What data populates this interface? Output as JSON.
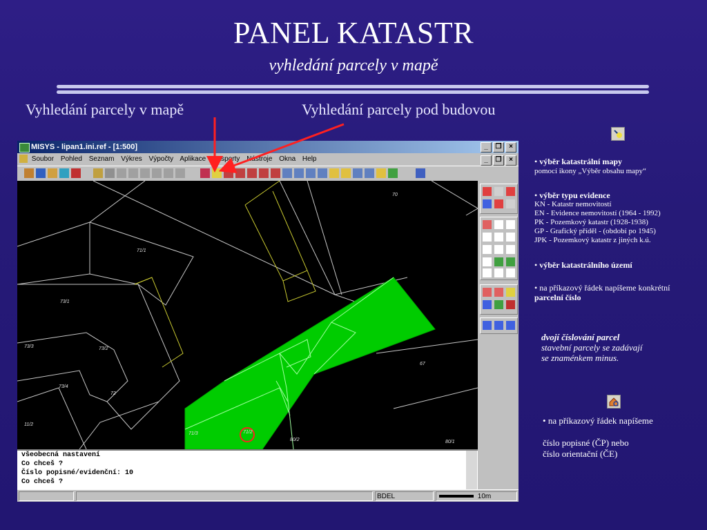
{
  "slide": {
    "title": "PANEL KATASTR",
    "subtitle": "vyhledání parcely v mapě",
    "caption_left": "Vyhledání parcely v mapě",
    "caption_right": "Vyhledání parcely pod budovou"
  },
  "window": {
    "title": "MISYS - lipan1.ini.ref - [1:500]",
    "menu": [
      "Soubor",
      "Pohled",
      "Seznam",
      "Výkres",
      "Výpočty",
      "Aplikace",
      "Pasporty",
      "Nástroje",
      "Okna",
      "Help"
    ],
    "map_labels": [
      "70",
      "71/1",
      "73/1",
      "73/2",
      "73/3",
      "73/4",
      "72",
      "67",
      "71/2",
      "71/3",
      "80/2",
      "80/1",
      "11/2"
    ],
    "command_lines": [
      "všeobecná nastavení",
      "Co chceš ?",
      "Číslo popisné/evidenční: 10",
      "Co chceš ?"
    ],
    "status": {
      "mode": "BDEL",
      "scale": "10m"
    }
  },
  "right_panel": {
    "b1_bullet": "•",
    "b1_bold": "výběr katastrální mapy",
    "b1_text": "pomocí ikony „Výběr obsahu mapy“",
    "b2_bold": "výběr typu evidence",
    "evidence": [
      "KN  - Katastr nemovitostí",
      "EN  - Evidence nemovitostí (1964 - 1992)",
      "PK  - Pozemkový katastr (1928-1938)",
      "GP  - Grafický příděl - (období po 1945)",
      "JPK - Pozemkový katastr z jiných k.ú."
    ],
    "b3_bold": "výběr katastrálního území",
    "b4_text": "na příkazový řádek napíšeme konkrétní",
    "b4_bold": "parcelní číslo",
    "italic_title": "dvojí číslování parcel",
    "italic_line1": "stavební parcely se zadávají",
    "italic_line2": "se znaménkem minus.",
    "b5_text": "na příkazový řádek napíšeme",
    "b5_line2": "číslo popisné (ČP) nebo",
    "b5_line3": "číslo orientační (ČE)"
  },
  "colors": {
    "parcel_fill": "#00cc00",
    "arrow": "#ff2020",
    "background": "#261a78"
  },
  "icons": [
    "map-select-icon",
    "house-search-icon"
  ]
}
